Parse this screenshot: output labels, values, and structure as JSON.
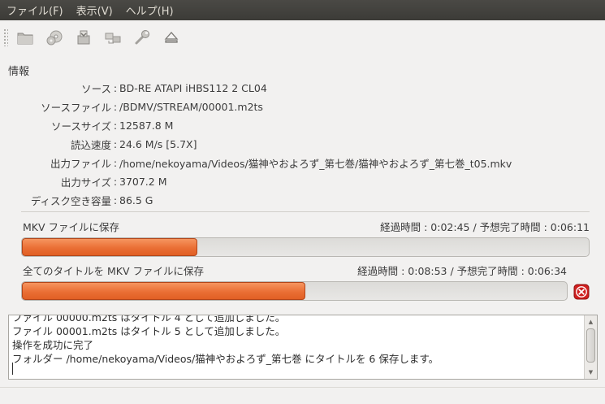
{
  "menu": {
    "file": "ファイル(F)",
    "view": "表示(V)",
    "help": "ヘルプ(H)"
  },
  "toolbar": {
    "icons": [
      "open-folder-icon",
      "open-disc-icon",
      "backup-icon",
      "stream-icon",
      "preferences-wrench-icon",
      "eject-icon"
    ]
  },
  "info": {
    "section_title": "情報",
    "colon": ":",
    "rows": [
      {
        "label": "ソース",
        "value": "BD-RE ATAPI iHBS112  2 CL04"
      },
      {
        "label": "ソースファイル",
        "value": "/BDMV/STREAM/00001.m2ts"
      },
      {
        "label": "ソースサイズ",
        "value": "12587.8 M"
      },
      {
        "label": "読込速度",
        "value": "24.6 M/s [5.7X]"
      },
      {
        "label": "出力ファイル",
        "value": "/home/nekoyama/Videos/猫神やおよろず_第七巻/猫神やおよろず_第七巻_t05.mkv"
      },
      {
        "label": "出力サイズ",
        "value": "3707.2 M"
      },
      {
        "label": "ディスク空き容量",
        "value": "86.5 G"
      }
    ]
  },
  "progress": {
    "current": {
      "label": "MKV ファイルに保存",
      "times": "経過時間 : 0:02:45 / 予想完了時間 : 0:06:11",
      "fraction": 0.31
    },
    "total": {
      "label": "全てのタイトルを MKV ファイルに保存",
      "times": "経過時間 : 0:08:53 / 予想完了時間 : 0:06:34",
      "fraction": 0.52
    }
  },
  "log": {
    "lines": [
      "ファイル 00000.m2ts はタイトル 4 として追加しました。",
      "ファイル 00001.m2ts はタイトル 5 として追加しました。",
      "操作を成功に完了",
      "フォルダー /home/nekoyama/Videos/猫神やおよろず_第七巻 にタイトルを 6 保存します。"
    ]
  },
  "colors": {
    "menubar": "#3c3b37",
    "progress_fill": "#ea6f35",
    "cancel_red": "#d01f1f"
  }
}
